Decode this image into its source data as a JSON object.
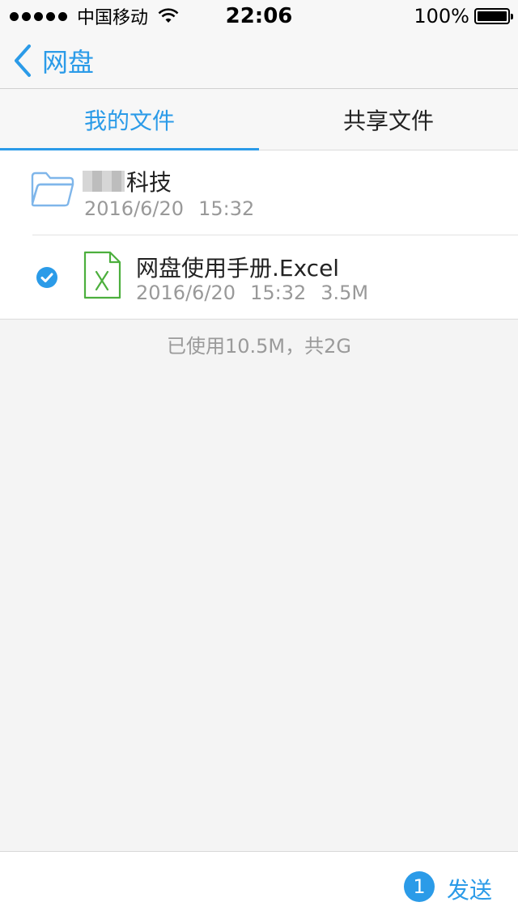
{
  "status_bar": {
    "carrier": "中国移动",
    "time": "22:06",
    "battery": "100%"
  },
  "nav": {
    "back_label": "网盘"
  },
  "tabs": [
    {
      "label": "我的文件",
      "active": true
    },
    {
      "label": "共享文件",
      "active": false
    }
  ],
  "files": [
    {
      "name": "科技",
      "date": "2016/6/20",
      "time": "15:32",
      "size": "",
      "type": "folder-icon",
      "selected": false
    },
    {
      "name": "网盘使用手册.Excel",
      "date": "2016/6/20",
      "time": "15:32",
      "size": "3.5M",
      "type": "excel-icon",
      "selected": true
    }
  ],
  "usage_text": "已使用10.5M，共2G",
  "bottom": {
    "selected_count": "1",
    "send_label": "发送"
  },
  "colors": {
    "accent": "#2b9be8",
    "excel_green": "#4caf3d",
    "folder_blue": "#7fb6ea"
  }
}
